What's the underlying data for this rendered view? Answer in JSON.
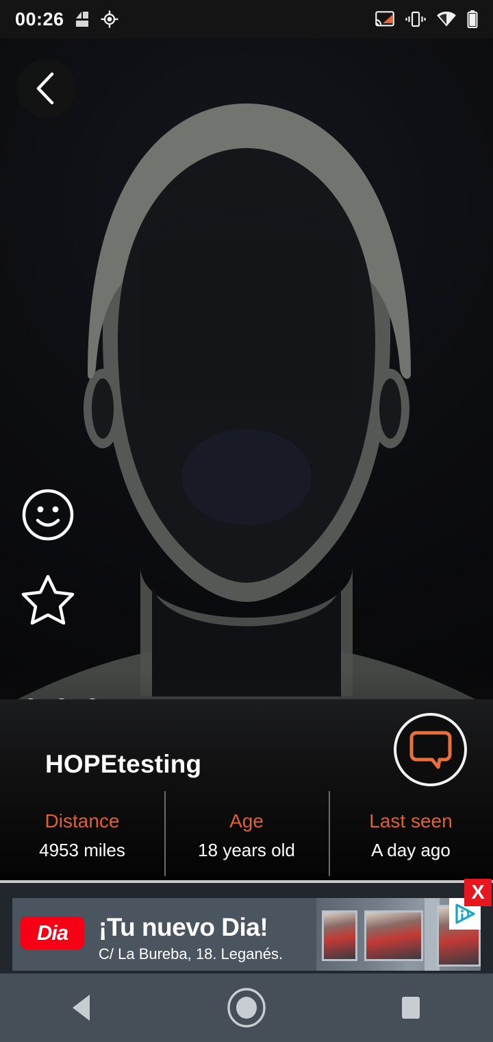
{
  "status_bar": {
    "time": "00:26",
    "left_icons": [
      "app-notification-icon",
      "gps-location-icon"
    ],
    "right_icons": [
      "cast-screen-icon",
      "vibrate-mode-icon",
      "wifi-icon",
      "battery-icon"
    ],
    "cast_color": "#e8643c"
  },
  "photo": {
    "back_button_icon": "chevron-left-icon",
    "avatar_type": "default-person-silhouette",
    "silhouette_color": "#585b58",
    "page_dots": 3,
    "side_actions": [
      {
        "name": "smiley-face-button",
        "icon": "smiley-face-icon"
      },
      {
        "name": "favorite-star-button",
        "icon": "star-icon"
      }
    ]
  },
  "profile": {
    "username": "HOPEtesting",
    "chat_button_icon": "chat-bubble-icon",
    "accent_color": "#e0612f",
    "stats": [
      {
        "label": "Distance",
        "value": "4953 miles"
      },
      {
        "label": "Age",
        "value": "18 years old"
      },
      {
        "label": "Last seen",
        "value": "A day ago"
      }
    ]
  },
  "advertisement": {
    "brand": "Dia",
    "headline": "¡Tu nuevo Dia!",
    "subtext": "C/ La Bureba, 18. Leganés.",
    "close_label": "X",
    "adchoices_icon": "adchoices-icon",
    "banner_bg": "#4a5560",
    "logo_bg": "#f50014"
  },
  "navigation_bar": {
    "buttons": [
      {
        "name": "nav-back-button",
        "icon": "triangle-back-icon"
      },
      {
        "name": "nav-home-button",
        "icon": "circle-home-icon"
      },
      {
        "name": "nav-recents-button",
        "icon": "square-recents-icon"
      }
    ]
  }
}
